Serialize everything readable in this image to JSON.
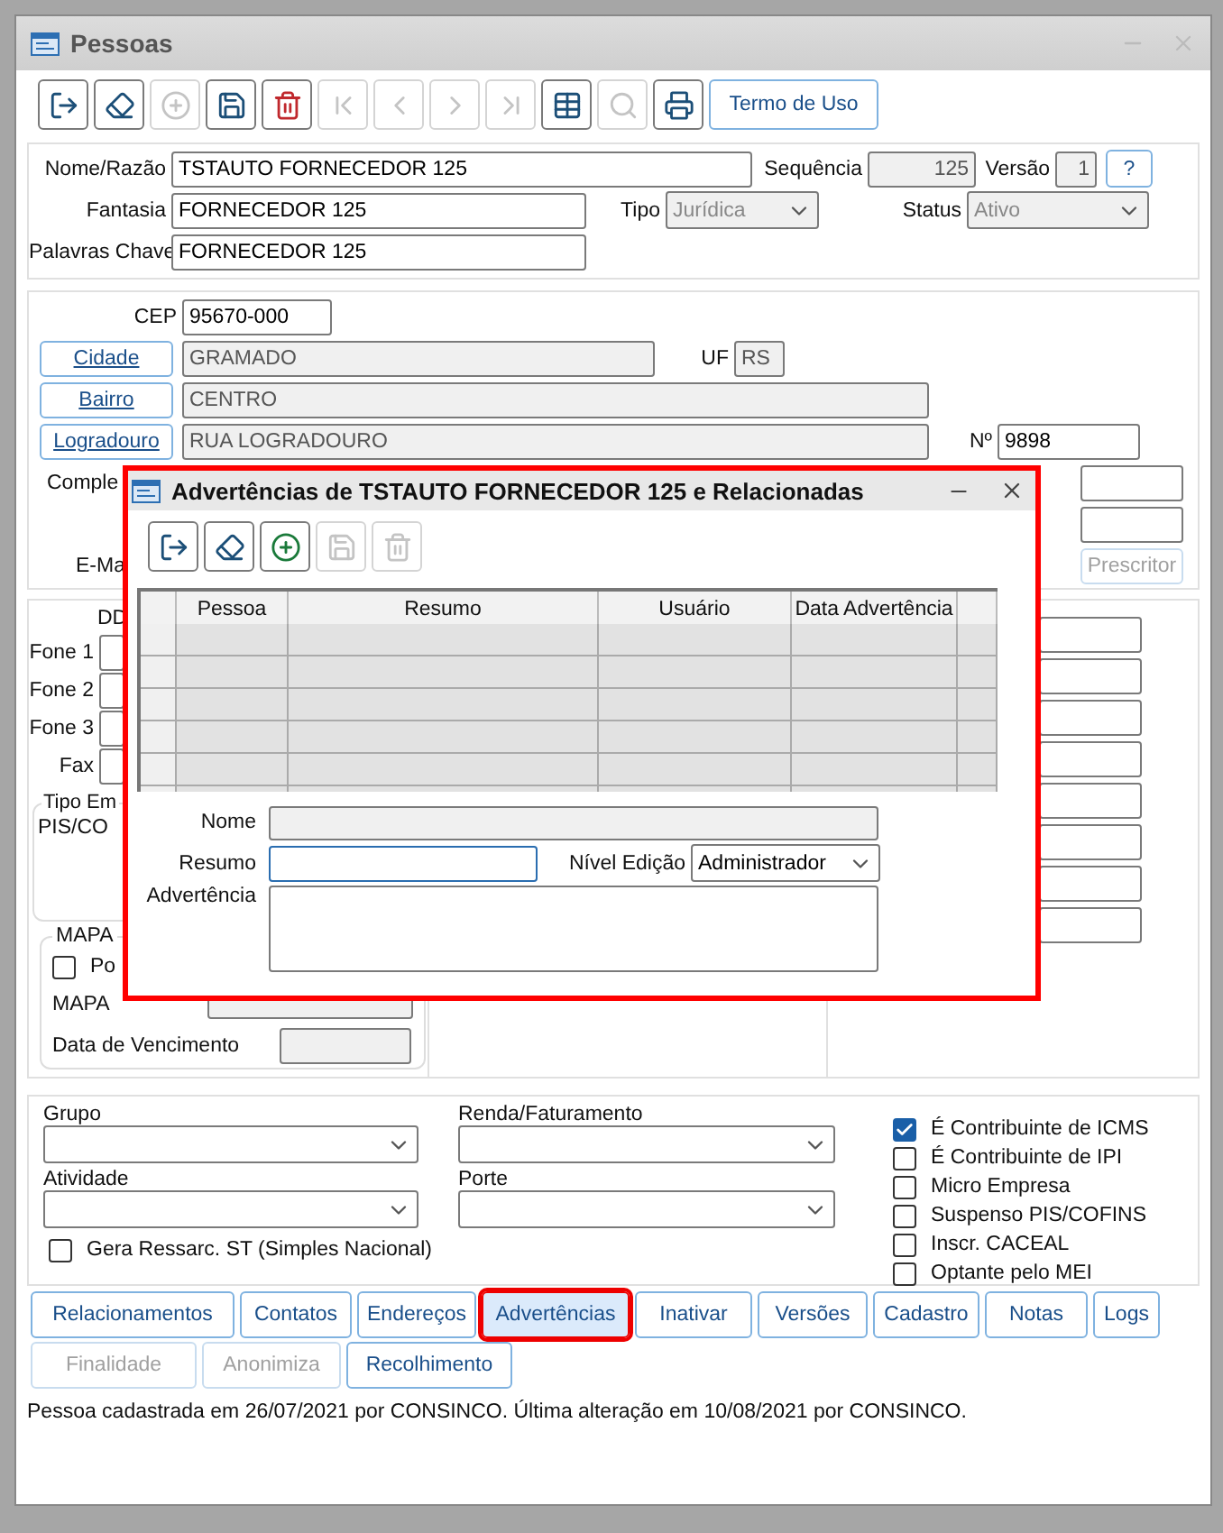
{
  "window": {
    "title": "Pessoas"
  },
  "toolbar": [
    {
      "kind": "exit",
      "disabled": false
    },
    {
      "kind": "eraser",
      "disabled": false
    },
    {
      "kind": "add",
      "disabled": true
    },
    {
      "kind": "save",
      "disabled": false
    },
    {
      "kind": "delete",
      "disabled": false
    },
    {
      "kind": "first",
      "disabled": true
    },
    {
      "kind": "prev",
      "disabled": true
    },
    {
      "kind": "next",
      "disabled": true
    },
    {
      "kind": "last",
      "disabled": true
    },
    {
      "kind": "grid",
      "disabled": false
    },
    {
      "kind": "search",
      "disabled": true
    },
    {
      "kind": "print",
      "disabled": false
    }
  ],
  "terms_button": "Termo de Uso",
  "identity": {
    "nome": {
      "label": "Nome/Razão",
      "value": "TSTAUTO FORNECEDOR 125",
      "readonly": false
    },
    "sequencia": {
      "label": "Sequência",
      "value": "125",
      "readonly": true
    },
    "versao": {
      "label": "Versão",
      "value": "1",
      "readonly": true
    },
    "help_button": "?",
    "fantasia": {
      "label": "Fantasia",
      "value": "FORNECEDOR 125",
      "readonly": false
    },
    "tipo": {
      "label": "Tipo",
      "value": "Jurídica",
      "disabled": true
    },
    "status": {
      "label": "Status",
      "value": "Ativo",
      "disabled": true
    },
    "palavras_chave": {
      "label": "Palavras Chave",
      "value": "FORNECEDOR 125",
      "readonly": false
    }
  },
  "address": {
    "cep": {
      "label": "CEP",
      "value": "95670-000",
      "readonly": false
    },
    "cidade": {
      "label": "Cidade",
      "value": "GRAMADO",
      "readonly": true
    },
    "uf": {
      "label": "UF",
      "value": "RS",
      "readonly": true
    },
    "bairro": {
      "label": "Bairro",
      "value": "CENTRO",
      "readonly": true
    },
    "logradouro": {
      "label": "Logradouro",
      "value": "RUA LOGRADOURO",
      "readonly": true
    },
    "numero": {
      "label": "Nº",
      "value": "9898",
      "readonly": false
    },
    "complemento_label": "Comple",
    "email_label": "E-Ma",
    "prescritor_button": "Prescritor"
  },
  "phones": {
    "header": "DD",
    "rows": [
      {
        "label": "Fone 1"
      },
      {
        "label": "Fone 2"
      },
      {
        "label": "Fone 3"
      },
      {
        "label": "Fax"
      }
    ]
  },
  "tipo_group": {
    "title": "Tipo Em",
    "label": "PIS/CO"
  },
  "mapa_group": {
    "title": "MAPA",
    "checkbox": {
      "label": "Po",
      "checked": false
    },
    "mapa_label": "MAPA",
    "vencimento_label": "Data de Vencimento"
  },
  "classification": {
    "grupo": {
      "label": "Grupo"
    },
    "renda": {
      "label": "Renda/Faturamento"
    },
    "atividade": {
      "label": "Atividade"
    },
    "porte": {
      "label": "Porte"
    },
    "gera": {
      "label": "Gera Ressarc. ST (Simples Nacional)",
      "checked": false
    },
    "flags": [
      {
        "label": "É Contribuinte de ICMS",
        "checked": true
      },
      {
        "label": "É Contribuinte de IPI",
        "checked": false
      },
      {
        "label": "Micro Empresa",
        "checked": false
      },
      {
        "label": "Suspenso PIS/COFINS",
        "checked": false
      },
      {
        "label": "Inscr. CACEAL",
        "checked": false
      },
      {
        "label": "Optante pelo MEI",
        "checked": false
      }
    ]
  },
  "action_buttons": [
    {
      "label": "Relacionamentos",
      "selected": false
    },
    {
      "label": "Contatos",
      "selected": false
    },
    {
      "label": "Endereços",
      "selected": false
    },
    {
      "label": "Advertências",
      "selected": true
    },
    {
      "label": "Inativar",
      "selected": false
    },
    {
      "label": "Versões",
      "selected": false
    },
    {
      "label": "Cadastro",
      "selected": false
    },
    {
      "label": "Notas",
      "selected": false
    },
    {
      "label": "Logs",
      "selected": false
    }
  ],
  "secondary_buttons": [
    {
      "label": "Finalidade",
      "disabled": true
    },
    {
      "label": "Anonimiza",
      "disabled": true
    },
    {
      "label": "Recolhimento",
      "disabled": false
    }
  ],
  "status_bar": "Pessoa cadastrada em 26/07/2021 por CONSINCO. Última alteração em 10/08/2021 por CONSINCO.",
  "dialog": {
    "title": "Advertências de TSTAUTO FORNECEDOR 125 e Relacionadas",
    "toolbar": [
      {
        "kind": "exit",
        "disabled": false
      },
      {
        "kind": "eraser",
        "disabled": false
      },
      {
        "kind": "add",
        "disabled": false
      },
      {
        "kind": "save",
        "disabled": true
      },
      {
        "kind": "delete",
        "disabled": true
      }
    ],
    "table": {
      "columns": [
        "Pessoa",
        "Resumo",
        "Usuário",
        "Data Advertência"
      ]
    },
    "nome_label": "Nome",
    "resumo_label": "Resumo",
    "nivel": {
      "label": "Nível Edição",
      "value": "Administrador"
    },
    "advertencia_label": "Advertência"
  }
}
